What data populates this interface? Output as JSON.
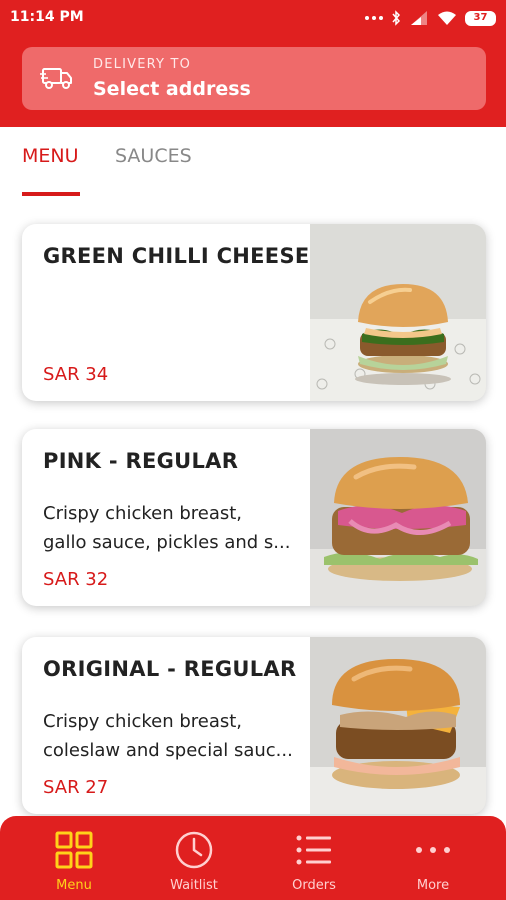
{
  "status_bar": {
    "time": "11:14 PM",
    "battery": "37"
  },
  "delivery": {
    "label": "DELIVERY TO",
    "address": "Select address",
    "icon": "truck-icon"
  },
  "tabs": [
    {
      "label": "MENU",
      "active": true
    },
    {
      "label": "SAUCES",
      "active": false
    }
  ],
  "menu_items": [
    {
      "title": "GREEN CHILLI CHEESE",
      "description": [],
      "price": "SAR 34"
    },
    {
      "title": "PINK - REGULAR",
      "description": [
        "Crispy chicken breast,",
        "gallo sauce, pickles and s..."
      ],
      "price": "SAR 32"
    },
    {
      "title": "ORIGINAL - REGULAR",
      "description": [
        "Crispy chicken breast,",
        "coleslaw and special sauc..."
      ],
      "price": "SAR 27"
    }
  ],
  "bottom_nav": [
    {
      "label": "Menu",
      "icon": "grid-icon",
      "active": true
    },
    {
      "label": "Waitlist",
      "icon": "clock-icon",
      "active": false
    },
    {
      "label": "Orders",
      "icon": "list-icon",
      "active": false
    },
    {
      "label": "More",
      "icon": "more-dots-icon",
      "active": false
    }
  ],
  "colors": {
    "brand_red": "#e02020",
    "accent_red": "#d71a1a",
    "active_nav": "#ffd21a"
  }
}
